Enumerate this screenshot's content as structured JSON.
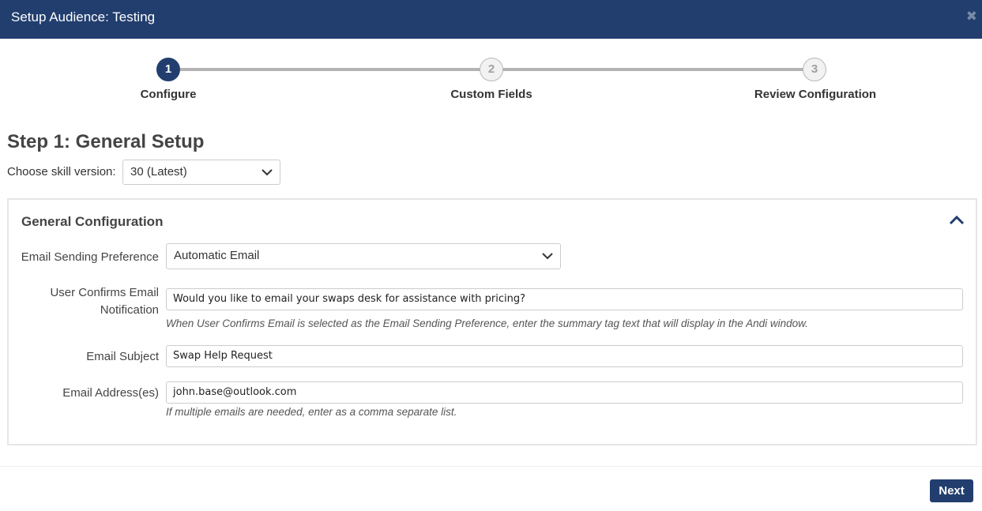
{
  "window": {
    "title": "Setup Audience: Testing",
    "close_icon": "close-icon"
  },
  "stepper": {
    "steps": [
      {
        "number": "1",
        "label": "Configure",
        "state": "active"
      },
      {
        "number": "2",
        "label": "Custom Fields",
        "state": "inactive"
      },
      {
        "number": "3",
        "label": "Review Configuration",
        "state": "inactive"
      }
    ]
  },
  "page": {
    "heading": "Step 1: General Setup",
    "skill_version_label": "Choose skill version:",
    "skill_version_value": "30 (Latest)"
  },
  "general": {
    "title": "General Configuration",
    "toggle_icon": "chevron-up-icon",
    "email_pref_label": "Email Sending Preference",
    "email_pref_value": "Automatic Email",
    "confirm_label_line1": "User Confirms Email",
    "confirm_label_line2": "Notification",
    "confirm_value": "Would you like to email your swaps desk for assistance with pricing?",
    "confirm_help": "When User Confirms Email is selected as the Email Sending Preference, enter the summary tag text that will display in the Andi window.",
    "subject_label": "Email Subject",
    "subject_value": "Swap Help Request",
    "address_label": "Email Address(es)",
    "address_value": "john.base@outlook.com",
    "address_help": "If multiple emails are needed, enter as a comma separate list."
  },
  "footer": {
    "next_label": "Next"
  },
  "colors": {
    "brand": "#213e6e",
    "step_line": "#b3b3b3"
  }
}
